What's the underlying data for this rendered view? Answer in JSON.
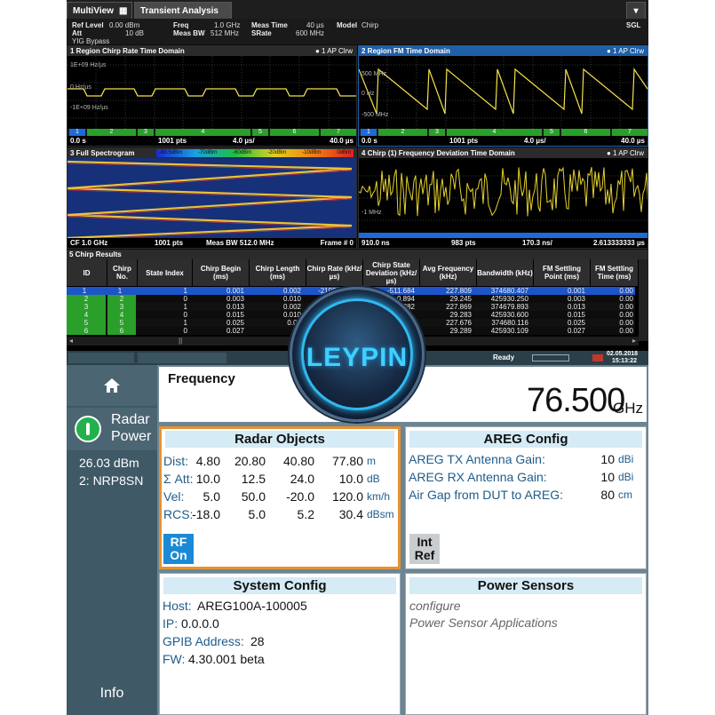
{
  "tabs": {
    "multiview": "MultiView",
    "transient": "Transient Analysis",
    "sgl": "SGL"
  },
  "header": {
    "ref_level_k": "Ref Level",
    "ref_level_v": "0.00 dBm",
    "att_k": "Att",
    "att_v": "10 dB",
    "yig": "YIG Bypass",
    "freq_k": "Freq",
    "freq_v": "1.0 GHz",
    "measbw_k": "Meas BW",
    "measbw_v": "512 MHz",
    "meastime_k": "Meas Time",
    "meastime_v": "40 µs",
    "srate_k": "SRate",
    "srate_v": "600 MHz",
    "model_k": "Model",
    "model_v": "Chirp"
  },
  "panes": {
    "p1": {
      "title": "1 Region Chirp Rate Time Domain",
      "badge": "● 1 AP Clrw",
      "y1": "1E+09 Hz/µs",
      "y2": "0 Hz/µs",
      "y3": "-1E+09 Hz/µs",
      "f1": "0.0 s",
      "f2": "1001 pts",
      "f3": "4.0 µs/",
      "f4": "40.0 µs"
    },
    "p2": {
      "title": "2 Region FM Time Domain",
      "badge": "● 1 AP Clrw",
      "y1": "500 MHz",
      "y2": "0 Hz",
      "y3": "-500 MHz",
      "f1": "0.0 s",
      "f2": "1001 pts",
      "f3": "4.0 µs/",
      "f4": "40.0 µs"
    },
    "p3": {
      "title": "3 Full Spectrogram",
      "f1": "CF 1.0 GHz",
      "f2": "1001 pts",
      "f3": "Meas BW 512.0 MHz",
      "f4": "Frame # 0",
      "scale": [
        "-89.5dBm",
        "-70dBm",
        "-60dBm",
        "-20dBm",
        "-10dBm",
        "0dBm"
      ]
    },
    "p4": {
      "title": "4 Chirp (1) Frequency Deviation Time Domain",
      "badge": "● 1 AP Clrw",
      "y2": "-1 MHz",
      "f1": "910.0 ns",
      "f2": "983 pts",
      "f3": "170.3 ns/",
      "f4": "2.613333333 µs"
    },
    "segments": [
      "1",
      "2",
      "3",
      "4",
      "5",
      "6",
      "7"
    ]
  },
  "table": {
    "title": "5 Chirp Results",
    "headers": [
      "ID",
      "Chirp No.",
      "State Index",
      "Chirp Begin (ms)",
      "Chirp Length (ms)",
      "Chirp Rate (kHz/µs)",
      "Chirp State Deviation (kHz/µs)",
      "Avg Frequency (kHz)",
      "Bandwidth (kHz)",
      "FM Settling Point (ms)",
      "FM Settling Time (ms)"
    ],
    "rows": [
      [
        "1",
        "1",
        "1",
        "0.001",
        "0.002",
        "-219968.038",
        "-511.684",
        "227.809",
        "374680.407",
        "0.001",
        "0.00"
      ],
      [
        "2",
        "2",
        "0",
        "0.003",
        "0.010",
        "",
        "0.894",
        "29.245",
        "425930.250",
        "0.003",
        "0.00"
      ],
      [
        "3",
        "3",
        "1",
        "0.013",
        "0.002",
        "",
        "382",
        "227.869",
        "374679.893",
        "0.013",
        "0.00"
      ],
      [
        "4",
        "4",
        "0",
        "0.015",
        "0.010",
        "",
        "",
        "29.283",
        "425930.600",
        "0.015",
        "0.00"
      ],
      [
        "5",
        "5",
        "1",
        "0.025",
        "0.00",
        "",
        "",
        "227.676",
        "374680.116",
        "0.025",
        "0.00"
      ],
      [
        "6",
        "6",
        "0",
        "0.027",
        "0",
        "",
        "",
        "29.289",
        "425930.109",
        "0.027",
        "0.00"
      ]
    ]
  },
  "statusbar": {
    "ready": "Ready",
    "date": "02.05.2018",
    "time": "15:13:22"
  },
  "watermark": "LEYPIN",
  "side": {
    "home_icon": "home-icon",
    "radar_label": "Radar",
    "power_label": "Power",
    "dbm": "26.03 dBm",
    "sensor": "2: NRP8SN",
    "info": "Info"
  },
  "frequency": {
    "label": "Frequency",
    "value": "76.500",
    "unit": "GHz"
  },
  "radar": {
    "title": "Radar Objects",
    "rows": [
      {
        "label": "Dist:",
        "vals": [
          "4.80",
          "20.80",
          "40.80",
          "77.80"
        ],
        "unit": "m"
      },
      {
        "label": "Σ Att:",
        "vals": [
          "10.0",
          "12.5",
          "24.0",
          "10.0"
        ],
        "unit": "dB"
      },
      {
        "label": "Vel:",
        "vals": [
          "5.0",
          "50.0",
          "-20.0",
          "120.0"
        ],
        "unit": "km/h"
      },
      {
        "label": "RCS:",
        "vals": [
          "-18.0",
          "5.0",
          "5.2",
          "30.4"
        ],
        "unit": "dBsm"
      }
    ],
    "rf_line1": "RF",
    "rf_line2": "On"
  },
  "areg": {
    "title": "AREG Config",
    "rows": [
      {
        "label": "AREG TX Antenna Gain:",
        "val": "10",
        "unit": "dBi"
      },
      {
        "label": "AREG RX Antenna Gain:",
        "val": "10",
        "unit": "dBi"
      },
      {
        "label": "Air Gap from DUT to AREG:",
        "val": "80",
        "unit": "cm"
      }
    ],
    "ref_line1": "Int",
    "ref_line2": "Ref"
  },
  "system": {
    "title": "System Config",
    "rows": [
      {
        "label": "Host:",
        "val": "AREG100A-100005"
      },
      {
        "label": "IP:",
        "val": "0.0.0.0"
      },
      {
        "label": "GPIB Address:",
        "val": "28"
      },
      {
        "label": "FW:",
        "val": "4.30.001 beta"
      }
    ]
  },
  "sensors": {
    "title": "Power Sensors",
    "link1": "configure",
    "link2": "Power Sensor Applications"
  }
}
